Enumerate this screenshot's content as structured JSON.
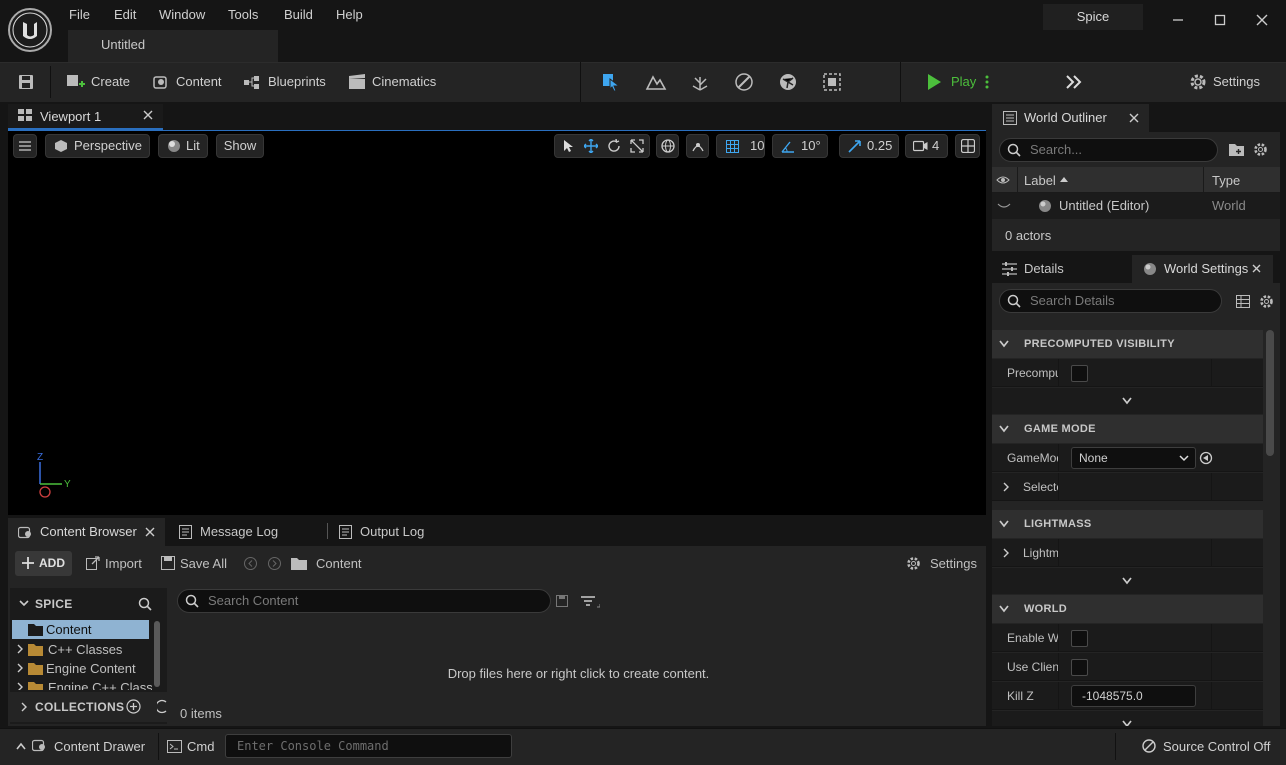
{
  "menu": [
    "File",
    "Edit",
    "Window",
    "Tools",
    "Build",
    "Help"
  ],
  "document_tab": "Untitled",
  "project_name": "Spice",
  "toolbar": {
    "create": "Create",
    "content": "Content",
    "blueprints": "Blueprints",
    "cinematics": "Cinematics",
    "play": "Play",
    "settings": "Settings"
  },
  "viewport": {
    "tab": "Viewport 1",
    "perspective": "Perspective",
    "lit": "Lit",
    "show": "Show",
    "grid_snap": "10",
    "rotation_snap": "10°",
    "scale_snap": "0.25",
    "camera_speed": "4",
    "axis_z": "Z",
    "axis_y": "Y"
  },
  "outliner": {
    "tab": "World Outliner",
    "search_placeholder": "Search...",
    "col_label": "Label",
    "col_type": "Type",
    "row_label": "Untitled (Editor)",
    "row_type": "World",
    "actor_count": "0 actors"
  },
  "details": {
    "tab_details": "Details",
    "tab_world_settings": "World Settings",
    "search_placeholder": "Search Details",
    "sections": {
      "precomputed": "PRECOMPUTED VISIBILITY",
      "game_mode": "GAME MODE",
      "lightmass": "LIGHTMASS",
      "world": "WORLD"
    },
    "props": {
      "precompu": "Precompu",
      "gamemod": "GameMod",
      "gamemode_value": "None",
      "selecte": "Selecte",
      "lightm": "Lightm",
      "enable_wo": "Enable Wo",
      "use_client": "Use Client",
      "kill_z": "Kill Z",
      "kill_z_value": "-1048575.0"
    }
  },
  "bottom_tabs": {
    "content_browser": "Content Browser",
    "message_log": "Message Log",
    "output_log": "Output Log"
  },
  "content_browser": {
    "add": "ADD",
    "import": "Import",
    "save_all": "Save All",
    "path": "Content",
    "settings": "Settings",
    "project_header": "SPICE",
    "tree": [
      "Content",
      "C++ Classes",
      "Engine Content",
      "Engine C++ Classe"
    ],
    "collections": "COLLECTIONS",
    "search_placeholder": "Search Content",
    "empty_msg": "Drop files here or right click to create content.",
    "item_count": "0 items"
  },
  "statusbar": {
    "content_drawer": "Content Drawer",
    "cmd": "Cmd",
    "console_placeholder": "Enter Console Command",
    "source_control": "Source Control Off"
  },
  "colors": {
    "accent": "#2a6fbf",
    "play_green": "#4cbf3c",
    "select_blue": "#3ea6f0"
  }
}
